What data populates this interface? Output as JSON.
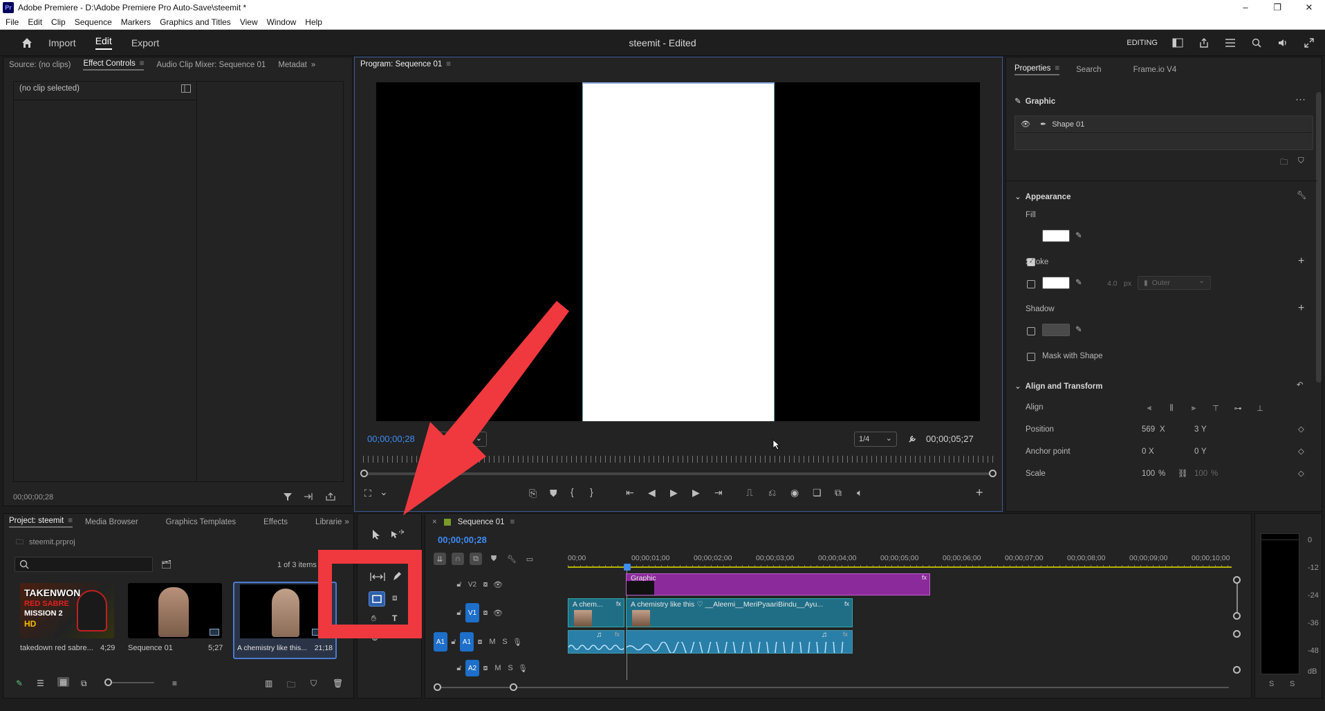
{
  "window": {
    "app_badge": "Pr",
    "title": "Adobe Premiere - D:\\Adobe Premiere Pro Auto-Save\\steemit *",
    "minimize": "–",
    "maximize": "❐",
    "close": "✕"
  },
  "menu": [
    "File",
    "Edit",
    "Clip",
    "Sequence",
    "Markers",
    "Graphics and Titles",
    "View",
    "Window",
    "Help"
  ],
  "header": {
    "nav": [
      "Import",
      "Edit",
      "Export"
    ],
    "active_nav": "Edit",
    "project_title": "steemit - Edited",
    "workspace_label": "EDITING"
  },
  "source_panel": {
    "tabs": [
      "Source: (no clips)",
      "Effect Controls",
      "Audio Clip Mixer: Sequence 01",
      "Metadat"
    ],
    "active_tab": "Effect Controls",
    "no_clip": "(no clip selected)",
    "timecode": "00;00;00;28"
  },
  "program_monitor": {
    "tab": "Program: Sequence 01",
    "current_timecode": "00;00;00;28",
    "fit_label": "Fit",
    "resolution": "1/4",
    "duration": "00;00;05;27"
  },
  "properties": {
    "tabs": [
      "Properties",
      "Search",
      "Frame.io V4"
    ],
    "active_tab": "Properties",
    "section_graphic": "Graphic",
    "layer_name": "Shape 01",
    "appearance": "Appearance",
    "fill": "Fill",
    "stroke": "Stroke",
    "stroke_width": "4.0",
    "stroke_unit": "px",
    "stroke_position": "Outer",
    "shadow": "Shadow",
    "mask_with_shape": "Mask with Shape",
    "align_transform": "Align and Transform",
    "align": "Align",
    "position": "Position",
    "position_x": "569",
    "position_y": "3",
    "anchor_point": "Anchor point",
    "anchor_x": "0",
    "anchor_y": "0",
    "scale": "Scale",
    "scale_x": "100",
    "scale_y": "100",
    "x_label": "X",
    "y_label": "Y",
    "pct": "%"
  },
  "project_panel": {
    "tabs": [
      "Project: steemit",
      "Media Browser",
      "Graphics Templates",
      "Effects",
      "Librarie"
    ],
    "active_tab": "Project: steemit",
    "project_file": "steemit.prproj",
    "search_placeholder": "",
    "items_count": "1 of 3 items s",
    "items": [
      {
        "name": "takedown red sabre...",
        "duration": "4;29"
      },
      {
        "name": "Sequence 01",
        "duration": "5;27"
      },
      {
        "name": "A chemistry like this...",
        "duration": "21;18"
      }
    ],
    "thumb1_text_1": "TAKENWON",
    "thumb1_text_2": "RED SABRE",
    "thumb1_text_3": "MISSION 2",
    "thumb1_text_4": "HD"
  },
  "timeline": {
    "sequence_tab": "Sequence 01",
    "timecode": "00;00;00;28",
    "ruler": [
      "00;00",
      "00;00;01;00",
      "00;00;02;00",
      "00;00;03;00",
      "00;00;04;00",
      "00;00;05;00",
      "00;00;06;00",
      "00;00;07;00",
      "00;00;08;00",
      "00;00;09;00",
      "00;00;10;00"
    ],
    "tracks": {
      "v2": "V2",
      "v1": "V1",
      "a1": "A1",
      "a2": "A2",
      "a1_src": "A1",
      "m": "M",
      "s": "S"
    },
    "clips": {
      "graphic": "Graphic",
      "v1_short": "A chem...",
      "v1_long": "A chemistry like this ♡ __Aleemi__MeriPyaariBindu__Ayu..."
    }
  },
  "audio_meter": {
    "scale": [
      "0",
      "-12",
      "-24",
      "-36",
      "-48",
      "dB"
    ],
    "solo": [
      "S",
      "S"
    ]
  },
  "colors": {
    "annotation_red": "#f0393e",
    "graphic_clip": "#8b2a9b",
    "video_clip": "#1f6e86",
    "audio_clip": "#2a7fa8",
    "accent_blue": "#3e8cf5"
  }
}
